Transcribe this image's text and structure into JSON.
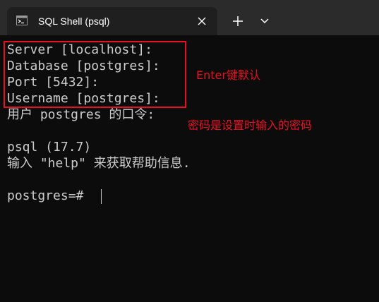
{
  "window": {
    "tab_title": "SQL Shell (psql)",
    "tab_icon": "terminal-icon",
    "close_icon": "close-icon",
    "new_tab_icon": "plus-icon",
    "dropdown_icon": "chevron-down-icon"
  },
  "terminal": {
    "lines": [
      "Server [localhost]:",
      "Database [postgres]:",
      "Port [5432]:",
      "Username [postgres]:",
      "用户 postgres 的口令:",
      "",
      "psql (17.7)",
      "输入 \"help\" 来获取帮助信息.",
      "",
      "postgres=#"
    ]
  },
  "annotations": {
    "defaults_note": "Enter键默认",
    "password_note": "密码是设置时输入的密码",
    "color": "#e81123"
  },
  "colors": {
    "background": "#0c0c0c",
    "tabbar": "#2b2b2b",
    "active_tab": "#1f1f1f",
    "text": "#cccccc"
  }
}
